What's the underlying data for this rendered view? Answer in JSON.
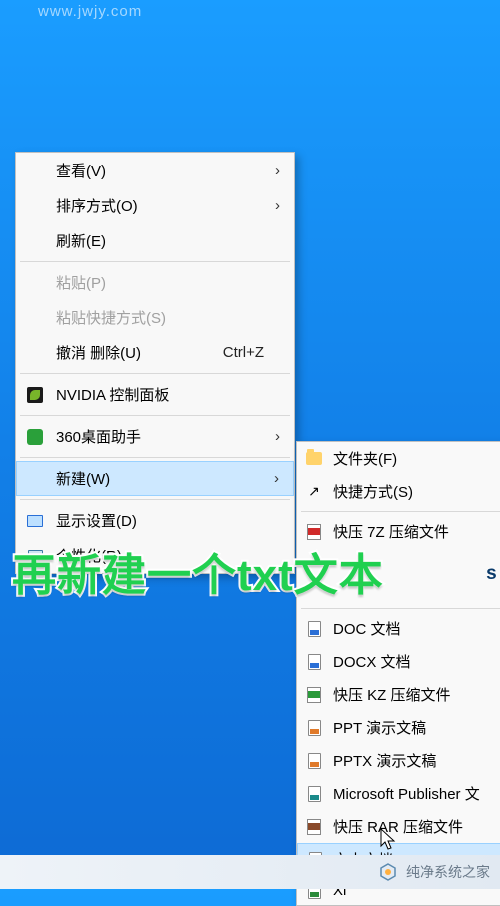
{
  "watermark_top": "www.jwjy.com",
  "context_menu": {
    "items": [
      {
        "label": "查看(V)",
        "has_submenu": true
      },
      {
        "label": "排序方式(O)",
        "has_submenu": true
      },
      {
        "label": "刷新(E)"
      },
      {
        "sep": true
      },
      {
        "label": "粘贴(P)",
        "disabled": true
      },
      {
        "label": "粘贴快捷方式(S)",
        "disabled": true
      },
      {
        "label": "撤消 删除(U)",
        "shortcut": "Ctrl+Z"
      },
      {
        "sep": true
      },
      {
        "label": "NVIDIA 控制面板",
        "icon": "nvidia-icon"
      },
      {
        "sep": true
      },
      {
        "label": "360桌面助手",
        "icon": "360-icon",
        "has_submenu": true
      },
      {
        "sep": true
      },
      {
        "label": "新建(W)",
        "has_submenu": true,
        "highlighted": true
      },
      {
        "sep": true
      },
      {
        "label": "显示设置(D)",
        "icon": "display-icon"
      },
      {
        "label": "个性化(R)",
        "icon": "personalize-icon"
      }
    ]
  },
  "submenu": {
    "items": [
      {
        "label": "文件夹(F)",
        "icon": "folder-icon"
      },
      {
        "label": "快捷方式(S)",
        "icon": "shortcut-icon"
      },
      {
        "sep": true
      },
      {
        "label": "快压 7Z 压缩文件",
        "icon": "zip-red-icon"
      },
      {
        "label": "s 数据",
        "icon": "doc-red-icon",
        "clipped": true
      },
      {
        "sep": true
      },
      {
        "label": "DOC 文档",
        "icon": "doc-blue-icon"
      },
      {
        "label": "DOCX 文档",
        "icon": "doc-blue-icon"
      },
      {
        "label": "快压 KZ 压缩文件",
        "icon": "zip-green-icon"
      },
      {
        "label": "PPT 演示文稿",
        "icon": "doc-orange-icon"
      },
      {
        "label": "PPTX 演示文稿",
        "icon": "doc-orange-icon"
      },
      {
        "label": "Microsoft Publisher 文",
        "icon": "doc-teal-icon"
      },
      {
        "label": "快压 RAR 压缩文件",
        "icon": "zip-brown-icon"
      },
      {
        "label": "文本文档",
        "icon": "doc-plain-icon",
        "highlighted": true
      },
      {
        "label": "Xl",
        "icon": "doc-green-icon",
        "clipped": true
      }
    ]
  },
  "caption": "再新建一个txt文本",
  "caption_side": "s 数据",
  "bottom_bar": {
    "text": "纯净系统之家"
  }
}
